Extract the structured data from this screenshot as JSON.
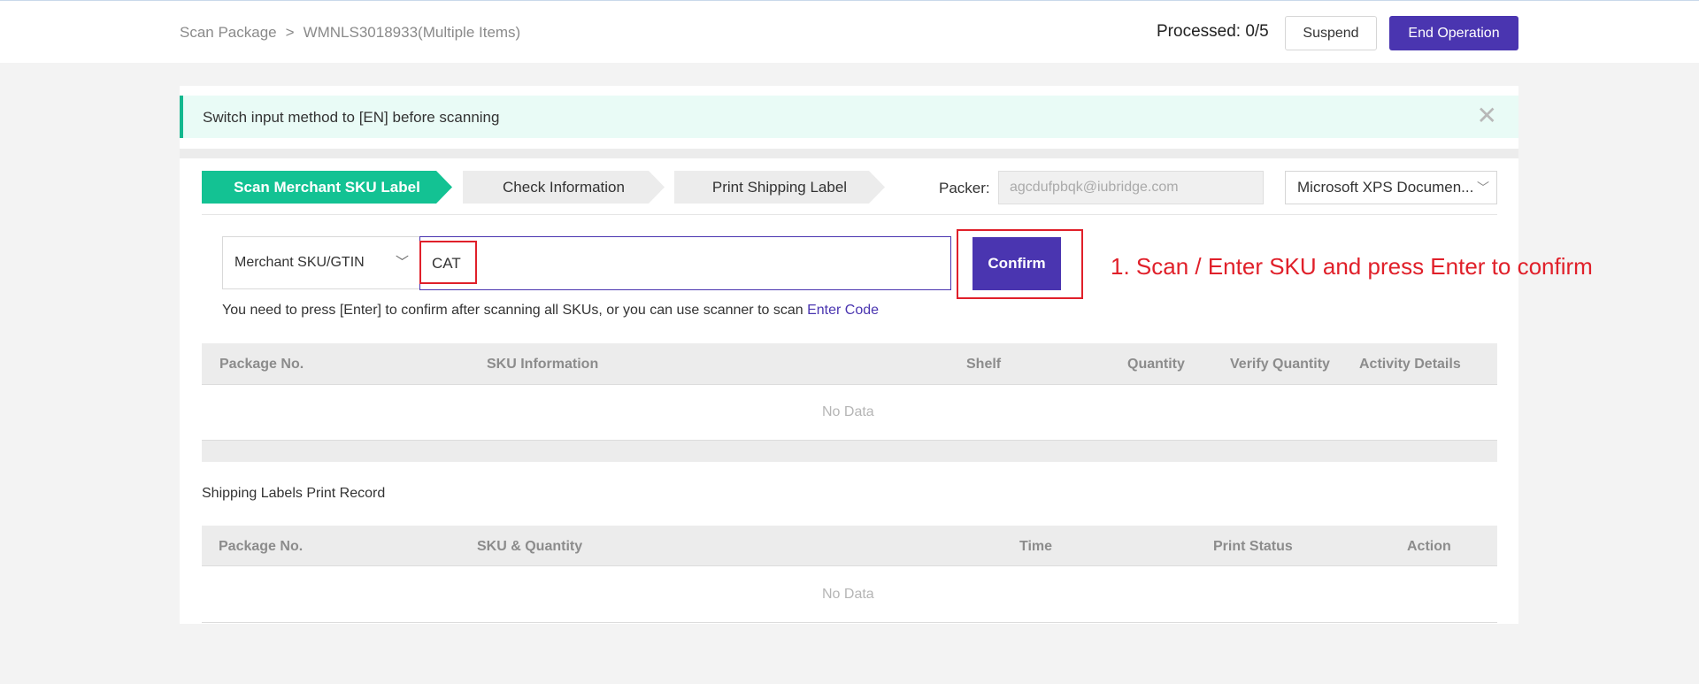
{
  "breadcrumb": {
    "root": "Scan Package",
    "separator": ">",
    "current": "WMNLS3018933(Multiple Items)"
  },
  "header": {
    "processed": "Processed: 0/5",
    "suspend_label": "Suspend",
    "end_label": "End Operation"
  },
  "alert": {
    "text": "Switch input method to [EN] before scanning",
    "close_glyph": "✕"
  },
  "steps": [
    {
      "label": "Scan Merchant SKU Label",
      "active": true
    },
    {
      "label": "Check Information",
      "active": false
    },
    {
      "label": "Print Shipping Label",
      "active": false
    }
  ],
  "packer": {
    "label": "Packer:",
    "value": "agcdufpbqk@iubridge.com"
  },
  "printer": {
    "selected": "Microsoft XPS Documen...",
    "chevron": "﹀"
  },
  "scan": {
    "type_selected": "Merchant SKU/GTIN",
    "type_chevron": "﹀",
    "input_value": "CAT",
    "confirm_label": "Confirm",
    "annotation": "1. Scan / Enter SKU and press Enter to confirm",
    "hint": "You need to press [Enter] to confirm after scanning all SKUs, or you can use scanner to scan ",
    "hint_link": "Enter Code"
  },
  "table1": {
    "headers": [
      "Package No.",
      "SKU Information",
      "Shelf",
      "Quantity",
      "Verify Quantity",
      "Activity Details"
    ],
    "empty": "No Data"
  },
  "print_record": {
    "title": "Shipping Labels Print Record"
  },
  "table2": {
    "headers": [
      "Package No.",
      "SKU & Quantity",
      "Time",
      "Print Status",
      "Action"
    ],
    "empty": "No Data"
  },
  "colors": {
    "brand_purple": "#4a35b0",
    "active_step_green": "#13c293",
    "alert_bg": "#e9fbf6",
    "annotation_red": "#e0202a"
  },
  "icons": [
    "close-icon",
    "chevron-down-icon"
  ]
}
